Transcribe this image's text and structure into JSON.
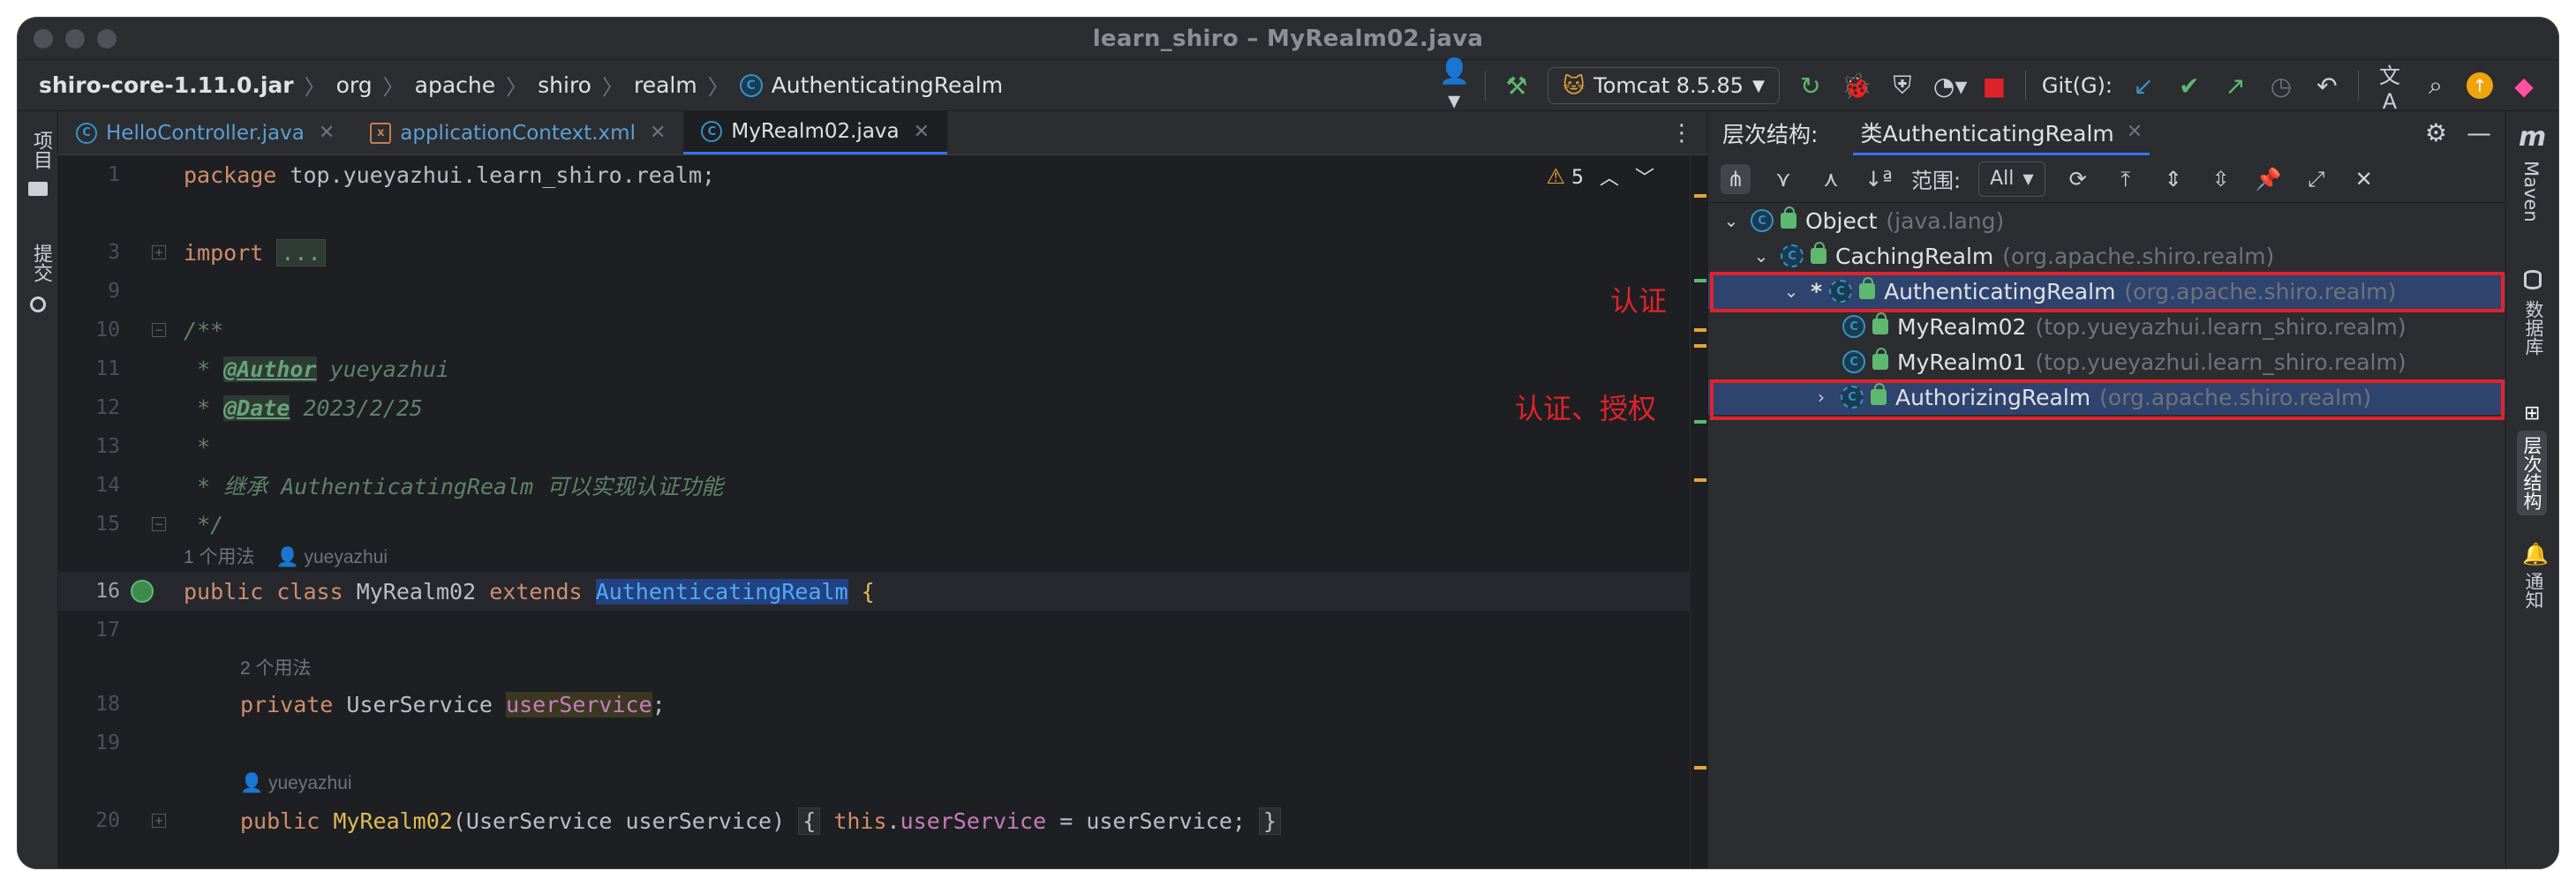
{
  "window": {
    "title": "learn_shiro – MyRealm02.java"
  },
  "breadcrumb": [
    "shiro-core-1.11.0.jar",
    "org",
    "apache",
    "shiro",
    "realm",
    "AuthenticatingRealm"
  ],
  "toolbar": {
    "run_config": "Tomcat 8.5.85",
    "git_label": "Git(G):"
  },
  "left_strip": {
    "project": "项目",
    "commit": "提交"
  },
  "editor": {
    "tabs": [
      {
        "label": "HelloController.java"
      },
      {
        "label": "applicationContext.xml"
      },
      {
        "label": "MyRealm02.java"
      }
    ],
    "warning_count": "5",
    "lines": {
      "l1": {
        "num": "1",
        "pkg_kw": "package",
        "pkg_name": " top.yueyazhui.learn_shiro.realm;"
      },
      "l3": {
        "num": "3",
        "kw": "import",
        "fold": "..."
      },
      "l9": {
        "num": "9"
      },
      "l10": {
        "num": "10",
        "text": "/**"
      },
      "l11": {
        "num": "11",
        "star": " * ",
        "tag": "@Author",
        "rest": " yueyazhui"
      },
      "l12": {
        "num": "12",
        "star": " * ",
        "tag": "@Date",
        "rest": " 2023/2/25"
      },
      "l13": {
        "num": "13",
        "text": " *"
      },
      "l14": {
        "num": "14",
        "text": " * 继承 AuthenticatingRealm 可以实现认证功能"
      },
      "l15": {
        "num": "15",
        "text": " */"
      },
      "h1": {
        "usages": "1 个用法",
        "author": "yueyazhui"
      },
      "l16": {
        "num": "16",
        "kw1": "public",
        "kw2": "class",
        "name": "MyRealm02",
        "kw3": "extends",
        "parent": "AuthenticatingRealm",
        "brace": "{"
      },
      "l17": {
        "num": "17"
      },
      "h2": {
        "usages": "2 个用法"
      },
      "l18": {
        "num": "18",
        "kw": "private",
        "type": "UserService",
        "field": "userService",
        "semi": ";"
      },
      "l19": {
        "num": "19"
      },
      "h3": {
        "author": "yueyazhui"
      },
      "l20": {
        "num": "20",
        "kw": "public",
        "ctor": "MyRealm02",
        "params": "(UserService userService) ",
        "ob": "{",
        "this": "this",
        "dot": ".",
        "field": "userService",
        "assign": " = userService;",
        "cb": "}"
      }
    }
  },
  "hierarchy": {
    "title": "层次结构:",
    "tab_label": "类AuthenticatingRealm",
    "scope_label": "范围:",
    "scope_value": "All",
    "nodes": [
      {
        "name": "Object",
        "pkg": "(java.lang)"
      },
      {
        "name": "CachingRealm",
        "pkg": "(org.apache.shiro.realm)"
      },
      {
        "star": "*",
        "name": "AuthenticatingRealm",
        "pkg": "(org.apache.shiro.realm)"
      },
      {
        "name": "MyRealm02",
        "pkg": "(top.yueyazhui.learn_shiro.realm)"
      },
      {
        "name": "MyRealm01",
        "pkg": "(top.yueyazhui.learn_shiro.realm)"
      },
      {
        "name": "AuthorizingRealm",
        "pkg": "(org.apache.shiro.realm)"
      }
    ],
    "annotations": {
      "auth": "认证",
      "auth_authz": "认证、授权"
    }
  },
  "right_strip": {
    "logo": "m",
    "maven": "Maven",
    "database": "数据库",
    "hierarchy": "层次结构",
    "notifications": "通知"
  },
  "colors": {
    "accent": "#3574f0",
    "annotation_red": "#e0232b",
    "bg_editor": "#1e1f22",
    "bg_panel": "#2b2d30"
  }
}
